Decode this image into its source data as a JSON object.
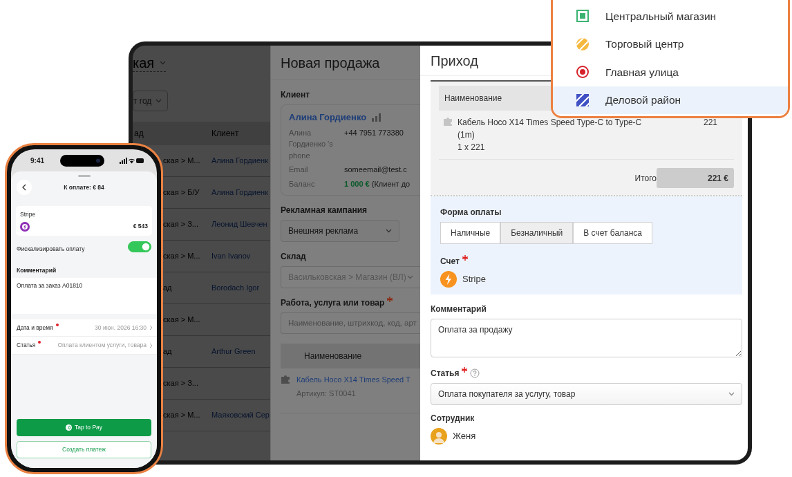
{
  "store_menu": {
    "items": [
      {
        "label": "Центральный магазин",
        "kind": "square",
        "color": "#3cb371",
        "selected": false
      },
      {
        "label": "Торговый центр",
        "kind": "hatched-circle",
        "color": "#f5b940",
        "selected": false
      },
      {
        "label": "Главная улица",
        "kind": "target",
        "color": "#d7202c",
        "selected": false
      },
      {
        "label": "Деловой район",
        "kind": "hatched-square",
        "color": "#3f51c4",
        "selected": true
      }
    ]
  },
  "sales_list": {
    "title": "кая",
    "period_filter": "т год",
    "columns": [
      "ад",
      "Клиент"
    ],
    "rows": [
      {
        "warehouse": "ская > М...",
        "client": "Алина Гордиенк"
      },
      {
        "warehouse": "ская > Б/У",
        "client": "Алина Гордиенк"
      },
      {
        "warehouse": "ская > З...",
        "client": "Леонид Шевчен"
      },
      {
        "warehouse": "ская > М...",
        "client": "Ivan Ivanov"
      },
      {
        "warehouse": "ад",
        "client": "Borodach Igor"
      },
      {
        "warehouse": "ская > М..."
      },
      {
        "warehouse": "ад",
        "client": "Arthur Green"
      },
      {
        "warehouse": "ская > З..."
      },
      {
        "warehouse": "ская > М...",
        "client": "Маяковский Сер"
      }
    ]
  },
  "new_sale": {
    "title": "Новая продажа",
    "client_label": "Клиент",
    "client": {
      "name": "Алина Гордиенко",
      "fields": [
        {
          "label": "Алина Гордиенко 's phone",
          "value": "+44 7951 773380"
        },
        {
          "label": "Email",
          "value": "someemail@test.c"
        },
        {
          "label": "Баланс",
          "value": "1 000 €",
          "note": "(Клиент до",
          "kind": "balance"
        }
      ]
    },
    "campaign": {
      "label": "Рекламная кампания",
      "value": "Внешняя реклама"
    },
    "warehouse": {
      "label": "Склад",
      "value": "Васильковская > Магазин (ВЛ)",
      "disabled": true
    },
    "product": {
      "label": "Работа, услуга или товар",
      "required": true,
      "placeholder": "Наименование, штрихкод, код, арт"
    },
    "table": {
      "columns": [
        "Наименование"
      ],
      "rows": [
        {
          "name": "Кабель Hoco X14 Times Speed T",
          "sku": "Артикул: ST0041"
        }
      ]
    }
  },
  "income": {
    "title": "Приход",
    "receipt": {
      "columns": [
        "Наименование"
      ],
      "items": [
        {
          "name": "Кабель Hoco X14 Times Speed Type-C to Type-C (1m)",
          "quantity": "1 x 221",
          "amount": "221"
        }
      ],
      "total_label": "Итого",
      "total": "221 €"
    },
    "payment_form": {
      "label": "Форма оплаты",
      "methods": [
        {
          "label": "Наличные",
          "selected": false
        },
        {
          "label": "Безналичный",
          "selected": true
        },
        {
          "label": "В счет баланса",
          "selected": false
        }
      ]
    },
    "account": {
      "label": "Счет",
      "required": true,
      "value": "Stripe"
    },
    "comment": {
      "label": "Комментарий",
      "value": "Оплата за продажу"
    },
    "category": {
      "label": "Статья",
      "required": true,
      "value": "Оплата покупателя за услугу, товар"
    },
    "employee": {
      "label": "Сотрудник",
      "name": "Женя"
    }
  },
  "phone": {
    "time": "9:41",
    "title": "К оплате: € 84",
    "payment": {
      "name": "Stripe",
      "amount": "€ 543"
    },
    "fiscalize": {
      "label": "Фискализировать оплату",
      "on": true
    },
    "comment": {
      "label": "Комментарий",
      "value": "Оплата за заказ А01810"
    },
    "fields": [
      {
        "label": "Дата и время",
        "required": true,
        "value": "30 июн. 2026 16:30"
      },
      {
        "label": "Статья",
        "required": true,
        "value": "Оплата клиентом услуги, товара"
      }
    ],
    "buttons": [
      {
        "label": "Tap to Pay",
        "kind": "primary"
      },
      {
        "label": "Создать платеж",
        "kind": "outline"
      }
    ]
  }
}
